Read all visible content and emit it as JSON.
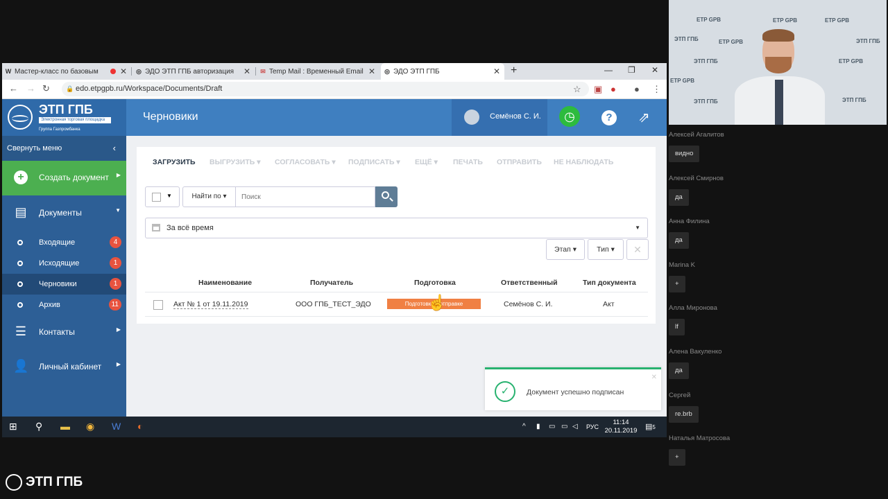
{
  "browser": {
    "tabs": [
      {
        "favicon": "W",
        "title": "Мастер-класс по базовым"
      },
      {
        "favicon": "globe",
        "title": "ЭДО ЭТП ГПБ авторизация"
      },
      {
        "favicon": "mail",
        "title": "Temp Mail : Временный Email"
      },
      {
        "favicon": "globe",
        "title": "ЭДО ЭТП ГПБ"
      }
    ],
    "url": "edo.etpgpb.ru/Workspace/Documents/Draft"
  },
  "app": {
    "logo_name": "ЭТП ГПБ",
    "logo_sub": "Электронная торговая площадка",
    "logo_group": "Группа Газпромбанка",
    "page_title": "Черновики",
    "user_name": "Семёнов С. И."
  },
  "sidebar": {
    "collapse_label": "Свернуть меню",
    "create_label": "Создать документ",
    "documents_label": "Документы",
    "sub": [
      {
        "label": "Входящие",
        "count": "4"
      },
      {
        "label": "Исходящие",
        "count": "1"
      },
      {
        "label": "Черновики",
        "count": "1"
      },
      {
        "label": "Архив",
        "count": "11"
      }
    ],
    "contacts_label": "Контакты",
    "cabinet_label": "Личный кабинет"
  },
  "toolbar": {
    "upload": "ЗАГРУЗИТЬ",
    "export": "ВЫГРУЗИТЬ",
    "approve": "СОГЛАСОВАТЬ",
    "sign": "ПОДПИСАТЬ",
    "more": "ЕЩЁ",
    "print": "ПЕЧАТЬ",
    "send": "ОТПРАВИТЬ",
    "not_watch": "НЕ НАБЛЮДАТЬ"
  },
  "filters": {
    "find_by": "Найти по",
    "search_placeholder": "Поиск",
    "period": "За всё время",
    "stage": "Этап",
    "type": "Тип"
  },
  "table": {
    "headers": {
      "name": "Наименование",
      "recipient": "Получатель",
      "stage": "Подготовка",
      "responsible": "Ответственный",
      "doc_type": "Тип документа"
    },
    "rows": [
      {
        "name": "Акт № 1 от 19.11.2019",
        "recipient": "ООО ГПБ_ТЕСТ_ЭДО",
        "stage": "Подготовка к отправке",
        "responsible": "Семёнов С. И.",
        "doc_type": "Акт"
      }
    ]
  },
  "toast": {
    "message": "Документ успешно подписан"
  },
  "taskbar": {
    "lang": "РУС",
    "time": "11:14",
    "date": "20.11.2019",
    "notif": "5"
  },
  "video": {
    "watermark": "ЭТП ГПБ",
    "watermark_en": "ETP GPB"
  },
  "chat": [
    {
      "name": "Алексей Агалитов",
      "msg": "видно"
    },
    {
      "name": "Алексей Смирнов",
      "msg": "да"
    },
    {
      "name": "Анна Филина",
      "msg": "да"
    },
    {
      "name": "Marina K",
      "msg": "+"
    },
    {
      "name": "Алла Миронова",
      "msg": "lf"
    },
    {
      "name": "Алена Вакуленко",
      "msg": "да"
    },
    {
      "name": "Сергей",
      "msg": "re.brb"
    },
    {
      "name": "Наталья Матросова",
      "msg": "+"
    }
  ],
  "bottom_logo": "ЭТП ГПБ",
  "colors": {
    "header_blue": "#3f7fc0",
    "sidebar_blue": "#2d5f96",
    "create_green": "#4caf50",
    "badge_red": "#e8533f",
    "stage_orange": "#f08043",
    "toast_green": "#27b26f"
  }
}
